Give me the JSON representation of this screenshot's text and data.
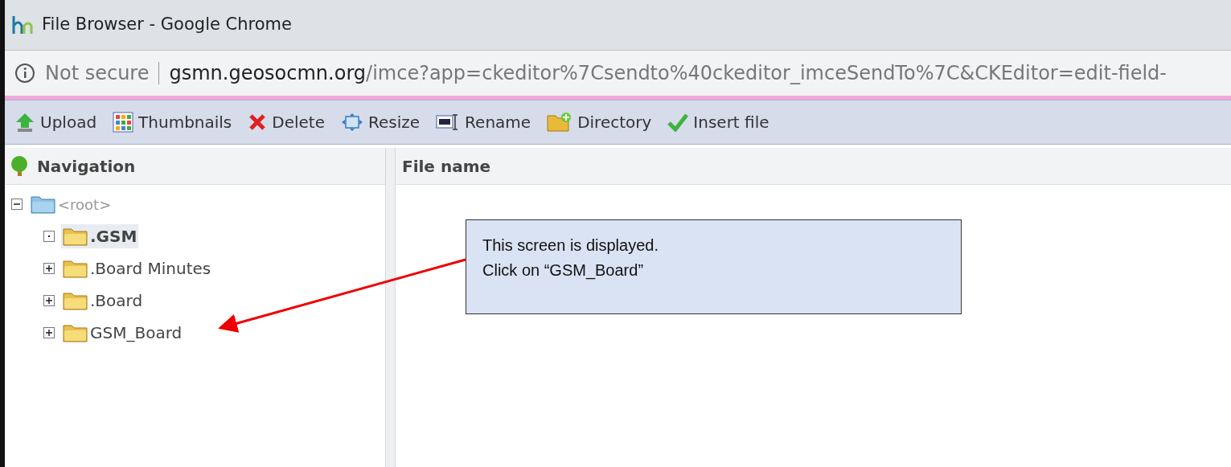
{
  "window": {
    "title": "File Browser - Google Chrome"
  },
  "address_bar": {
    "security": "Not secure",
    "host": "gsmn.geosocmn.org",
    "path": "/imce?app=ckeditor%7Csendto%40ckeditor_imceSendTo%7C&CKEditor=edit-field-"
  },
  "toolbar": [
    {
      "label": "Upload",
      "kind": "upload"
    },
    {
      "label": "Thumbnails",
      "kind": "thumbnails"
    },
    {
      "label": "Delete",
      "kind": "delete"
    },
    {
      "label": "Resize",
      "kind": "resize"
    },
    {
      "label": "Rename",
      "kind": "rename"
    },
    {
      "label": "Directory",
      "kind": "directory"
    },
    {
      "label": "Insert file",
      "kind": "insert"
    }
  ],
  "navigation": {
    "title": "Navigation",
    "tree": [
      {
        "label": "<root>",
        "kind": "root",
        "expanded": true,
        "empty": false,
        "selected": false,
        "children": [
          {
            "label": ".GSM",
            "kind": "folder",
            "empty": true,
            "selected": true
          },
          {
            "label": ".Board Minutes",
            "kind": "folder",
            "expanded": false,
            "empty": false,
            "selected": false
          },
          {
            "label": ".Board",
            "kind": "folder",
            "expanded": false,
            "empty": false,
            "selected": false
          },
          {
            "label": "GSM_Board",
            "kind": "folder",
            "expanded": false,
            "empty": false,
            "selected": false
          }
        ]
      }
    ]
  },
  "file_list": {
    "columns": [
      "File name"
    ]
  },
  "callout": {
    "lines": [
      "This screen is displayed.",
      "Click on “GSM_Board”"
    ]
  }
}
